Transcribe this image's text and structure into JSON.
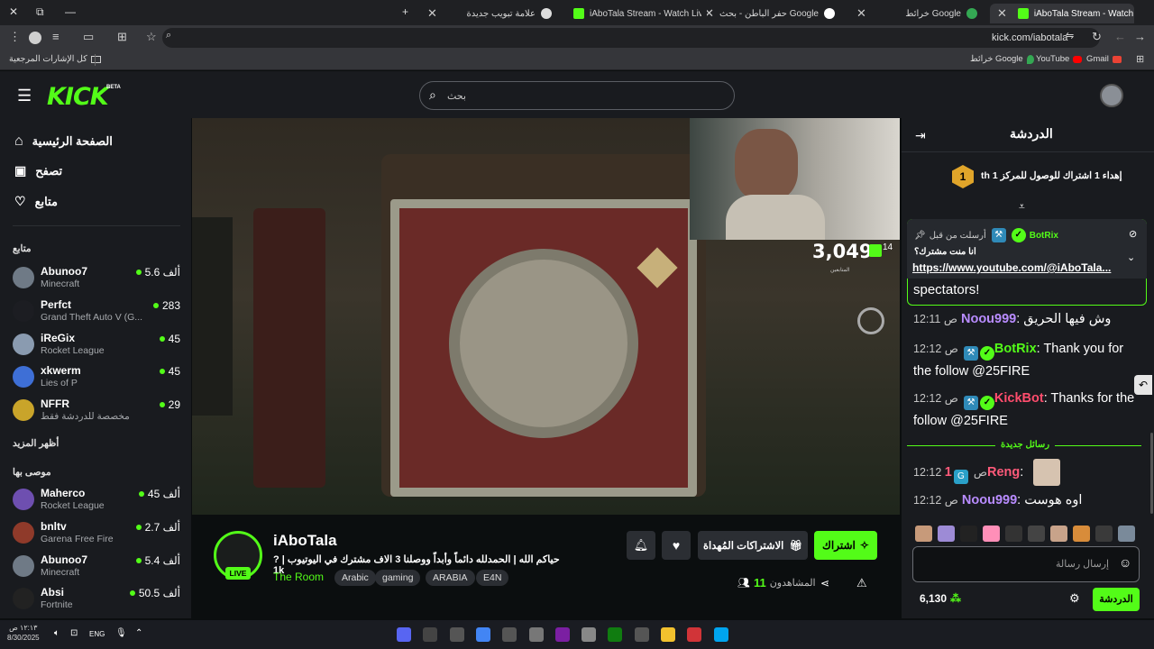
{
  "browser": {
    "tabs": [
      {
        "title": "iAboTala Stream - Watch Li",
        "active": true
      },
      {
        "title": "خرائط Google",
        "active": false
      },
      {
        "title": "حفر الباطن - بحث Google",
        "active": false
      },
      {
        "title": "iAboTala Stream - Watch Live o",
        "active": false
      },
      {
        "title": "علامة تبويب جديدة",
        "active": false
      }
    ],
    "url": "kick.com/iabotala",
    "bookmarks": {
      "folder": "كل الإشارات المرجعية",
      "items": [
        "Gmail",
        "YouTube",
        "خرائط Google"
      ]
    }
  },
  "kick": {
    "logo": "KICK",
    "beta": "BETA",
    "search_placeholder": "بحث",
    "nav": [
      {
        "label": "الصفحة الرئيسية"
      },
      {
        "label": "تصفح"
      },
      {
        "label": "متابع"
      }
    ],
    "following_title": "متابع",
    "following": [
      {
        "name": "Abunoo7",
        "game": "Minecraft",
        "viewers": "5.6 ألف",
        "color": "#6f7a86"
      },
      {
        "name": "Perfct",
        "game": "Grand Theft Auto V (G...",
        "viewers": "283",
        "color": "#1c1d22"
      },
      {
        "name": "iReGix",
        "game": "Rocket League",
        "viewers": "45",
        "color": "#8a9bb0"
      },
      {
        "name": "xkwerm",
        "game": "Lies of P",
        "viewers": "45",
        "color": "#3e6fd6"
      },
      {
        "name": "NFFR",
        "game": "مخصصة للدردشة فقط",
        "viewers": "29",
        "color": "#c9a42a"
      }
    ],
    "show_more": "أظهر المزيد",
    "recommended_title": "موصى بها",
    "recommended": [
      {
        "name": "Maherco",
        "game": "Rocket League",
        "viewers": "45 ألف",
        "color": "#6e4fb0"
      },
      {
        "name": "bnltv",
        "game": "Garena Free Fire",
        "viewers": "2.7 ألف",
        "color": "#8f3a2a"
      },
      {
        "name": "Abunoo7",
        "game": "Minecraft",
        "viewers": "5.4 ألف",
        "color": "#6f7a86"
      },
      {
        "name": "Absi",
        "game": "Fortnite",
        "viewers": "50.5 ألف",
        "color": "#222"
      }
    ]
  },
  "stream": {
    "overlay_count": "3,049",
    "overlay_small": "14",
    "overlay_sub": "المتابعين",
    "live": "LIVE",
    "channel": "iAboTala",
    "title": "حياكم الله | الحمدلله دائماً وأبداً ووصلنا 3 الاف مشترك في اليوتيوب | ?1k",
    "category": "The Room",
    "tags": [
      "Arabic",
      "gaming",
      "ARABIA",
      "E4N"
    ],
    "subscribe": "اشتراك",
    "gift": "الاشتراكات المُهداة",
    "viewers_label": "المشاهدون",
    "viewers": "11"
  },
  "chat": {
    "title": "الدردشة",
    "goal": "إهداء 1 اشتراك للوصول للمركز 1 th",
    "goal_rank": "1",
    "pinned_header": "أرسلت من قبل",
    "pinned_user": "BotRix",
    "pinned_q": "انا منت مشترك؟",
    "pinned_link": "https://www.youtube.com/@iAboTala...",
    "spectators": "spectators!",
    "messages": [
      {
        "time": "12:11 ص",
        "user": "Noou999",
        "color": "#b98cff",
        "text": "وش فيها الحريق"
      },
      {
        "time": "12:12 ص",
        "user": "BotRix",
        "color": "#53fc18",
        "text": "Thank you for the follow @25FIRE"
      },
      {
        "time": "12:12 ص",
        "user": "KickBot",
        "color": "#ff4d6d",
        "text": "Thanks for the follow @25FIRE"
      }
    ],
    "new_messages": "رسائل جديدة",
    "messages2": [
      {
        "time": "12:12 ص",
        "user": "1Reng",
        "color": "#ff5a7a",
        "text": ""
      },
      {
        "time": "12:12 ص",
        "user": "Noou999",
        "color": "#b98cff",
        "text": "اوه هوست"
      }
    ],
    "input_placeholder": "إرسال رسالة",
    "points": "6,130",
    "send": "الدردشة"
  },
  "taskbar": {
    "time": "١٢:١٣ ص",
    "date": "8/30/2025",
    "lang": "ENG"
  }
}
